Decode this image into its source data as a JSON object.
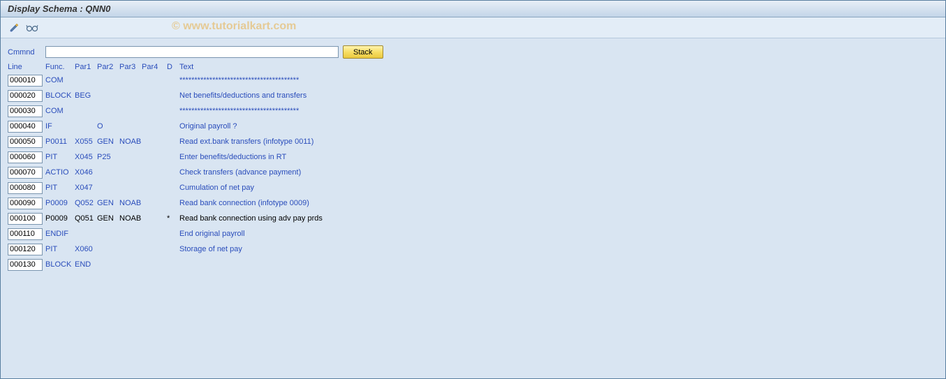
{
  "title": "Display Schema : QNN0",
  "watermark": "© www.tutorialkart.com",
  "cmmnd": {
    "label": "Cmmnd",
    "value": "",
    "stack_label": "Stack"
  },
  "headers": {
    "line": "Line",
    "func": "Func.",
    "par1": "Par1",
    "par2": "Par2",
    "par3": "Par3",
    "par4": "Par4",
    "d": "D",
    "text": "Text"
  },
  "rows": [
    {
      "line": "000010",
      "func": "COM",
      "par1": "",
      "par2": "",
      "par3": "",
      "par4": "",
      "d": "",
      "text": "****************************************",
      "link": true
    },
    {
      "line": "000020",
      "func": "BLOCK",
      "par1": "BEG",
      "par2": "",
      "par3": "",
      "par4": "",
      "d": "",
      "text": "Net benefits/deductions and transfers",
      "link": true
    },
    {
      "line": "000030",
      "func": "COM",
      "par1": "",
      "par2": "",
      "par3": "",
      "par4": "",
      "d": "",
      "text": "****************************************",
      "link": true
    },
    {
      "line": "000040",
      "func": "IF",
      "par1": "",
      "par2": "O",
      "par3": "",
      "par4": "",
      "d": "",
      "text": "Original payroll ?",
      "link": true
    },
    {
      "line": "000050",
      "func": "P0011",
      "par1": "X055",
      "par2": "GEN",
      "par3": "NOAB",
      "par4": "",
      "d": "",
      "text": " Read ext.bank transfers (infotype 0011)",
      "link": true
    },
    {
      "line": "000060",
      "func": "PIT",
      "par1": "X045",
      "par2": "P25",
      "par3": "",
      "par4": "",
      "d": "",
      "text": " Enter benefits/deductions in RT",
      "link": true
    },
    {
      "line": "000070",
      "func": "ACTIO",
      "par1": "X046",
      "par2": "",
      "par3": "",
      "par4": "",
      "d": "",
      "text": " Check transfers (advance payment)",
      "link": true
    },
    {
      "line": "000080",
      "func": "PIT",
      "par1": "X047",
      "par2": "",
      "par3": "",
      "par4": "",
      "d": "",
      "text": " Cumulation of net pay",
      "link": true
    },
    {
      "line": "000090",
      "func": "P0009",
      "par1": "Q052",
      "par2": "GEN",
      "par3": "NOAB",
      "par4": "",
      "d": "",
      "text": "Read bank connection (infotype 0009)",
      "link": true
    },
    {
      "line": "000100",
      "func": "P0009",
      "par1": "Q051",
      "par2": "GEN",
      "par3": "NOAB",
      "par4": "",
      "d": "*",
      "text": "Read bank connection using adv pay prds",
      "link": false
    },
    {
      "line": "000110",
      "func": "ENDIF",
      "par1": "",
      "par2": "",
      "par3": "",
      "par4": "",
      "d": "",
      "text": "End original payroll",
      "link": true
    },
    {
      "line": "000120",
      "func": "PIT",
      "par1": "X060",
      "par2": "",
      "par3": "",
      "par4": "",
      "d": "",
      "text": "Storage of net pay",
      "link": true
    },
    {
      "line": "000130",
      "func": "BLOCK",
      "par1": "END",
      "par2": "",
      "par3": "",
      "par4": "",
      "d": "",
      "text": "",
      "link": true
    }
  ]
}
